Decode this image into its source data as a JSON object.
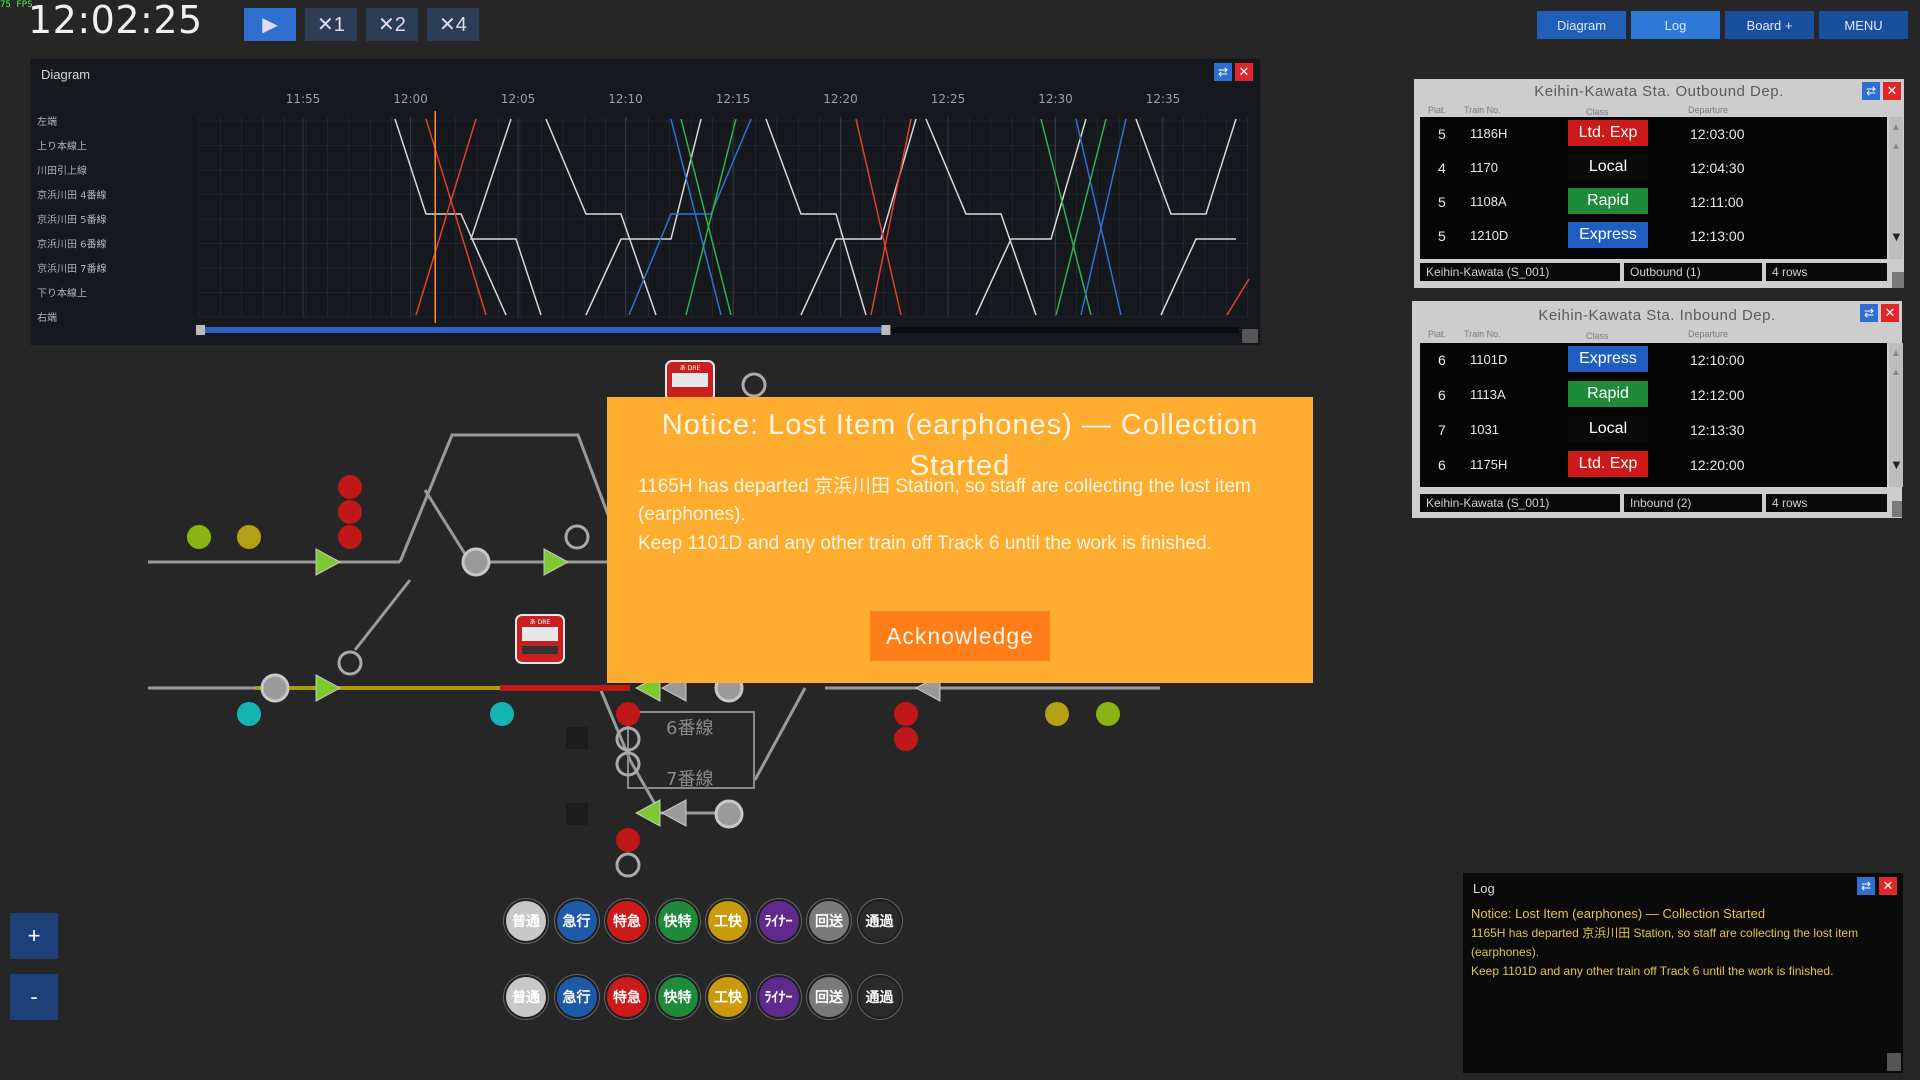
{
  "hud": {
    "fps": "75 FPS",
    "clock": "12:02:25"
  },
  "controls": {
    "play": "▶",
    "speeds": [
      "✕1",
      "✕2",
      "✕4"
    ]
  },
  "nav": {
    "diagram": "Diagram",
    "log": "Log",
    "board": "Board +",
    "menu": "MENU"
  },
  "diagram": {
    "title": "Diagram",
    "swap_icon": "⇄",
    "close_icon": "✕",
    "times": [
      "11:55",
      "12:00",
      "12:05",
      "12:10",
      "12:15",
      "12:20",
      "12:25",
      "12:30",
      "12:35"
    ],
    "stations": [
      "左端",
      "上り本線上",
      "川田引上線",
      "京浜川田 4番線",
      "京浜川田 5番線",
      "京浜川田 6番線",
      "京浜川田 7番線",
      "下り本線上",
      "右端"
    ],
    "current_time_fraction": 0.225,
    "scroll_position_fraction": 0.66
  },
  "board_outbound": {
    "title": "Keihin-Kawata Sta. Outbound Dep.",
    "headers": {
      "plat": "Plat.",
      "train": "Train No.",
      "class": "Class",
      "dep": "Departure"
    },
    "rows": [
      {
        "plat": "5",
        "train": "1186H",
        "class": "Ltd. Exp",
        "color": "#cc1a1a",
        "dep": "12:03:00"
      },
      {
        "plat": "4",
        "train": "1170",
        "class": "Local",
        "color": "#0a0a0a",
        "dep": "12:04:30"
      },
      {
        "plat": "5",
        "train": "1108A",
        "class": "Rapid",
        "color": "#1f8a3a",
        "dep": "12:11:00"
      },
      {
        "plat": "5",
        "train": "1210D",
        "class": "Express",
        "color": "#1f5ec0",
        "dep": "12:13:00"
      }
    ],
    "footer": {
      "station": "Keihin-Kawata (S_001)",
      "direction": "Outbound (1)",
      "rows": "4 rows"
    }
  },
  "board_inbound": {
    "title": "Keihin-Kawata Sta. Inbound Dep.",
    "headers": {
      "plat": "Plat.",
      "train": "Train No.",
      "class": "Class",
      "dep": "Departure"
    },
    "rows": [
      {
        "plat": "6",
        "train": "1101D",
        "class": "Express",
        "color": "#1f5ec0",
        "dep": "12:10:00"
      },
      {
        "plat": "6",
        "train": "1113A",
        "class": "Rapid",
        "color": "#1f8a3a",
        "dep": "12:12:00"
      },
      {
        "plat": "7",
        "train": "1031",
        "class": "Local",
        "color": "#0a0a0a",
        "dep": "12:13:30"
      },
      {
        "plat": "6",
        "train": "1175H",
        "class": "Ltd. Exp",
        "color": "#cc1a1a",
        "dep": "12:20:00"
      }
    ],
    "footer": {
      "station": "Keihin-Kawata (S_001)",
      "direction": "Inbound (2)",
      "rows": "4 rows"
    }
  },
  "notice": {
    "title": "Notice: Lost Item (earphones) — Collection Started",
    "line1": "1165H has departed 京浜川田 Station, so staff are collecting the lost item",
    "line2": "(earphones).",
    "line3": "Keep 1101D and any other train off Track 6 until the work is finished.",
    "button": "Acknowledge"
  },
  "log": {
    "title": "Log",
    "line1": "Notice: Lost Item (earphones) — Collection Started",
    "line2": "1165H has departed 京浜川田 Station, so staff are collecting the lost item",
    "line3": "(earphones).",
    "line4": "Keep 1101D and any other train off Track 6 until the work is finished."
  },
  "map": {
    "track6": "6番線",
    "track7": "7番線",
    "train_tag": "あ DRE"
  },
  "zoom": {
    "plus": "+",
    "minus": "-"
  },
  "train_classes": [
    {
      "label": "普通",
      "color": "#c8c8c8"
    },
    {
      "label": "急行",
      "color": "#1f5aa8"
    },
    {
      "label": "特急",
      "color": "#cc1a1a"
    },
    {
      "label": "快特",
      "color": "#1f8a3a"
    },
    {
      "label": "工快",
      "color": "#c99a0c"
    },
    {
      "label": "ﾗｲﾅｰ",
      "color": "#5e2a8e"
    },
    {
      "label": "回送",
      "color": "#7a7a7a"
    },
    {
      "label": "通過",
      "color": "#2a2a2a"
    }
  ],
  "colors": {
    "accent": "#2f6fd0",
    "notice": "#ffad31",
    "ack": "#ff7e1a",
    "occupied": "#c01818",
    "route": "#b4a40a"
  }
}
